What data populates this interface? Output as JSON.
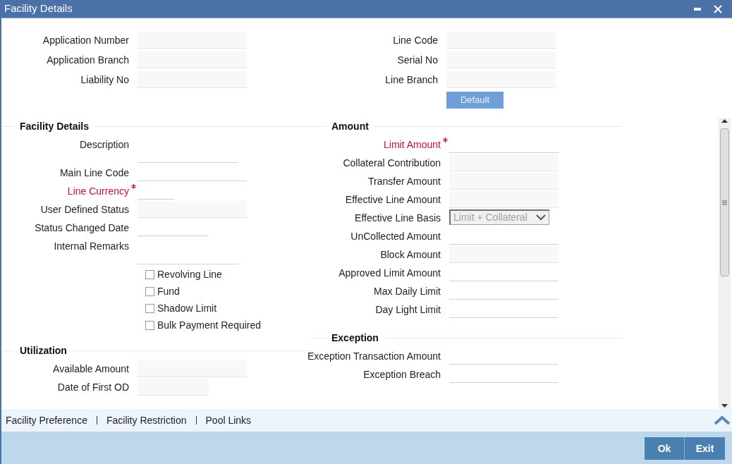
{
  "window": {
    "title": "Facility Details"
  },
  "header_fields": {
    "left": [
      {
        "label": "Application Number",
        "kind": "readonly",
        "required": false
      },
      {
        "label": "Application Branch",
        "kind": "readonly",
        "required": false
      },
      {
        "label": "Liability No",
        "kind": "readonly",
        "required": false
      }
    ],
    "right": [
      {
        "label": "Line Code",
        "kind": "readonly",
        "required": false
      },
      {
        "label": "Serial No",
        "kind": "readonly",
        "required": false
      },
      {
        "label": "Line Branch",
        "kind": "readonly",
        "required": false
      }
    ],
    "default_button": {
      "label": "Default",
      "disabled": true
    }
  },
  "facility_details": {
    "title": "Facility Details",
    "fields": [
      {
        "label": "Description",
        "kind": "textarea",
        "required": false
      },
      {
        "label": "Main Line Code",
        "kind": "input",
        "required": false
      },
      {
        "label": "Line Currency",
        "kind": "short",
        "required": true
      },
      {
        "label": "User Defined Status",
        "kind": "readonly",
        "required": false
      },
      {
        "label": "Status Changed Date",
        "kind": "medium",
        "required": false
      },
      {
        "label": "Internal Remarks",
        "kind": "textarea",
        "required": false
      }
    ],
    "checkboxes": [
      {
        "label": "Revolving Line",
        "checked": false
      },
      {
        "label": "Fund",
        "checked": false
      },
      {
        "label": "Shadow Limit",
        "checked": false
      },
      {
        "label": "Bulk Payment Required",
        "checked": false
      }
    ]
  },
  "utilization": {
    "title": "Utilization",
    "fields": [
      {
        "label": "Available Amount",
        "kind": "readonly",
        "required": false
      },
      {
        "label": "Date of First OD",
        "kind": "readonly_medium",
        "required": false
      }
    ]
  },
  "amount": {
    "title": "Amount",
    "fields": [
      {
        "label": "Limit Amount",
        "kind": "input",
        "required": true
      },
      {
        "label": "Collateral Contribution",
        "kind": "readonly",
        "required": false
      },
      {
        "label": "Transfer Amount",
        "kind": "readonly",
        "required": false
      },
      {
        "label": "Effective Line Amount",
        "kind": "readonly",
        "required": false
      },
      {
        "label": "Effective Line Basis",
        "kind": "select",
        "value": "Limit + Collateral",
        "required": false,
        "disabled": true
      },
      {
        "label": "UnCollected Amount",
        "kind": "input",
        "required": false
      },
      {
        "label": "Block Amount",
        "kind": "readonly",
        "required": false
      },
      {
        "label": "Approved Limit Amount",
        "kind": "input",
        "required": false
      },
      {
        "label": "Max Daily Limit",
        "kind": "input",
        "required": false
      },
      {
        "label": "Day Light Limit",
        "kind": "input",
        "required": false
      }
    ]
  },
  "exception": {
    "title": "Exception",
    "fields": [
      {
        "label": "Exception Transaction Amount",
        "kind": "input",
        "required": false
      },
      {
        "label": "Exception Breach",
        "kind": "input",
        "required": false
      }
    ]
  },
  "tabs": [
    {
      "label": "Facility Preference"
    },
    {
      "label": "Facility Restriction"
    },
    {
      "label": "Pool Links"
    }
  ],
  "buttons": [
    {
      "label": "Ok"
    },
    {
      "label": "Exit"
    }
  ]
}
